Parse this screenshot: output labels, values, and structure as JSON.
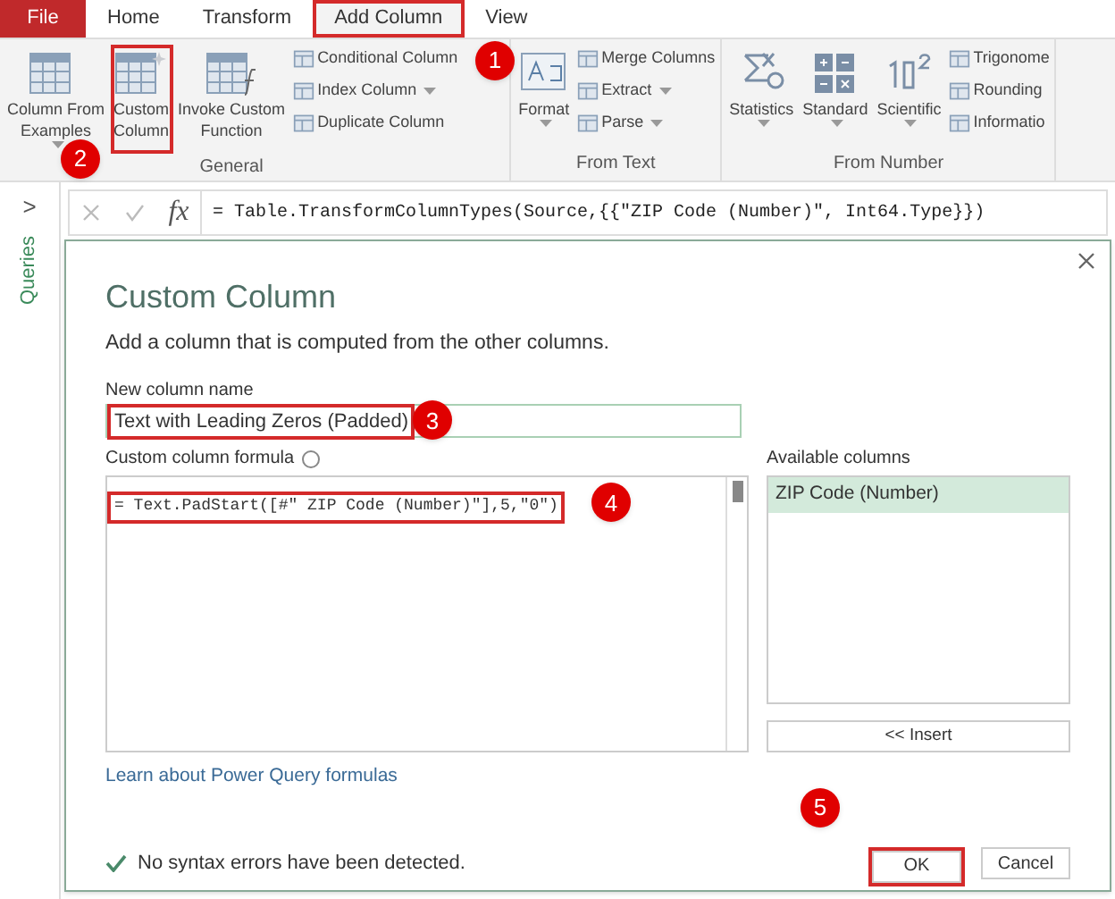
{
  "tabs": [
    {
      "label": "File",
      "kind": "file",
      "selected": false,
      "highlighted": false
    },
    {
      "label": "Home",
      "kind": "tab",
      "selected": false,
      "highlighted": false
    },
    {
      "label": "Transform",
      "kind": "tab",
      "selected": false,
      "highlighted": false
    },
    {
      "label": "Add Column",
      "kind": "tab",
      "selected": true,
      "highlighted": true
    },
    {
      "label": "View",
      "kind": "tab",
      "selected": false,
      "highlighted": false
    }
  ],
  "ribbon_groups": [
    {
      "label": "General",
      "items": [
        {
          "kind": "large",
          "lines": [
            "Column From",
            "Examples"
          ],
          "dropdown": true,
          "highlighted": false
        },
        {
          "kind": "large",
          "lines": [
            "Custom",
            "Column"
          ],
          "dropdown": false,
          "highlighted": true
        },
        {
          "kind": "large",
          "lines": [
            "Invoke Custom",
            "Function"
          ],
          "dropdown": false,
          "highlighted": false
        },
        {
          "kind": "small",
          "rows": [
            {
              "label": "Conditional Column",
              "dropdown": false
            },
            {
              "label": "Index Column",
              "dropdown": true
            },
            {
              "label": "Duplicate Column",
              "dropdown": false
            }
          ]
        }
      ]
    },
    {
      "label": "From Text",
      "items": [
        {
          "kind": "large",
          "lines": [
            "Format"
          ],
          "dropdown": true,
          "highlighted": false
        },
        {
          "kind": "small",
          "rows": [
            {
              "label": "Merge Columns",
              "dropdown": false
            },
            {
              "label": "Extract",
              "dropdown": true
            },
            {
              "label": "Parse",
              "dropdown": true
            }
          ]
        }
      ]
    },
    {
      "label": "From Number",
      "items": [
        {
          "kind": "large",
          "lines": [
            "Statistics"
          ],
          "dropdown": true,
          "highlighted": false
        },
        {
          "kind": "large",
          "lines": [
            "Standard"
          ],
          "dropdown": true,
          "highlighted": false
        },
        {
          "kind": "large",
          "lines": [
            "Scientific"
          ],
          "dropdown": true,
          "highlighted": false
        },
        {
          "kind": "small",
          "rows": [
            {
              "label": "Trigonome",
              "dropdown": false
            },
            {
              "label": "Rounding",
              "dropdown": false
            },
            {
              "label": "Informatio",
              "dropdown": false
            }
          ]
        }
      ]
    }
  ],
  "sidebar": {
    "label": "Queries",
    "expand": ">"
  },
  "formula_bar": {
    "fx": "fx",
    "value": "= Table.TransformColumnTypes(Source,{{\"ZIP Code (Number)\", Int64.Type}})"
  },
  "dialog": {
    "title": "Custom Column",
    "description": "Add a column that is computed from the other columns.",
    "name_label": "New column name",
    "name_value": "Text with Leading Zeros (Padded)",
    "name_highlighted": true,
    "formula_label": "Custom column formula",
    "formula_value": "= Text.PadStart([#\" ZIP Code (Number)\"],5,\"0\")",
    "formula_highlighted": true,
    "columns_label": "Available columns",
    "columns": [
      {
        "label": "ZIP Code (Number)",
        "selected": true
      }
    ],
    "insert_button": "<< Insert",
    "link": "Learn about Power Query formulas",
    "status": "No syntax errors have been detected.",
    "ok_button": "OK",
    "ok_highlighted": true,
    "cancel_button": "Cancel"
  },
  "callouts": [
    "1",
    "2",
    "3",
    "4",
    "5"
  ]
}
